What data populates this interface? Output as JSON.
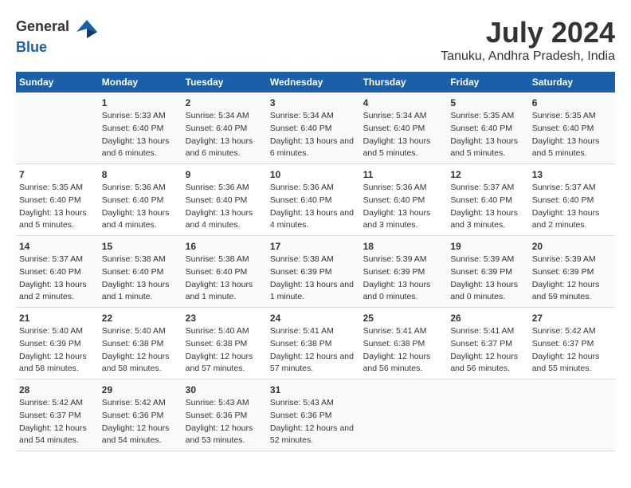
{
  "header": {
    "logo_general": "General",
    "logo_blue": "Blue",
    "month_year": "July 2024",
    "location": "Tanuku, Andhra Pradesh, India"
  },
  "days_of_week": [
    "Sunday",
    "Monday",
    "Tuesday",
    "Wednesday",
    "Thursday",
    "Friday",
    "Saturday"
  ],
  "weeks": [
    [
      {
        "day": "",
        "sunrise": "",
        "sunset": "",
        "daylight": ""
      },
      {
        "day": "1",
        "sunrise": "Sunrise: 5:33 AM",
        "sunset": "Sunset: 6:40 PM",
        "daylight": "Daylight: 13 hours and 6 minutes."
      },
      {
        "day": "2",
        "sunrise": "Sunrise: 5:34 AM",
        "sunset": "Sunset: 6:40 PM",
        "daylight": "Daylight: 13 hours and 6 minutes."
      },
      {
        "day": "3",
        "sunrise": "Sunrise: 5:34 AM",
        "sunset": "Sunset: 6:40 PM",
        "daylight": "Daylight: 13 hours and 6 minutes."
      },
      {
        "day": "4",
        "sunrise": "Sunrise: 5:34 AM",
        "sunset": "Sunset: 6:40 PM",
        "daylight": "Daylight: 13 hours and 5 minutes."
      },
      {
        "day": "5",
        "sunrise": "Sunrise: 5:35 AM",
        "sunset": "Sunset: 6:40 PM",
        "daylight": "Daylight: 13 hours and 5 minutes."
      },
      {
        "day": "6",
        "sunrise": "Sunrise: 5:35 AM",
        "sunset": "Sunset: 6:40 PM",
        "daylight": "Daylight: 13 hours and 5 minutes."
      }
    ],
    [
      {
        "day": "7",
        "sunrise": "Sunrise: 5:35 AM",
        "sunset": "Sunset: 6:40 PM",
        "daylight": "Daylight: 13 hours and 5 minutes."
      },
      {
        "day": "8",
        "sunrise": "Sunrise: 5:36 AM",
        "sunset": "Sunset: 6:40 PM",
        "daylight": "Daylight: 13 hours and 4 minutes."
      },
      {
        "day": "9",
        "sunrise": "Sunrise: 5:36 AM",
        "sunset": "Sunset: 6:40 PM",
        "daylight": "Daylight: 13 hours and 4 minutes."
      },
      {
        "day": "10",
        "sunrise": "Sunrise: 5:36 AM",
        "sunset": "Sunset: 6:40 PM",
        "daylight": "Daylight: 13 hours and 4 minutes."
      },
      {
        "day": "11",
        "sunrise": "Sunrise: 5:36 AM",
        "sunset": "Sunset: 6:40 PM",
        "daylight": "Daylight: 13 hours and 3 minutes."
      },
      {
        "day": "12",
        "sunrise": "Sunrise: 5:37 AM",
        "sunset": "Sunset: 6:40 PM",
        "daylight": "Daylight: 13 hours and 3 minutes."
      },
      {
        "day": "13",
        "sunrise": "Sunrise: 5:37 AM",
        "sunset": "Sunset: 6:40 PM",
        "daylight": "Daylight: 13 hours and 2 minutes."
      }
    ],
    [
      {
        "day": "14",
        "sunrise": "Sunrise: 5:37 AM",
        "sunset": "Sunset: 6:40 PM",
        "daylight": "Daylight: 13 hours and 2 minutes."
      },
      {
        "day": "15",
        "sunrise": "Sunrise: 5:38 AM",
        "sunset": "Sunset: 6:40 PM",
        "daylight": "Daylight: 13 hours and 1 minute."
      },
      {
        "day": "16",
        "sunrise": "Sunrise: 5:38 AM",
        "sunset": "Sunset: 6:40 PM",
        "daylight": "Daylight: 13 hours and 1 minute."
      },
      {
        "day": "17",
        "sunrise": "Sunrise: 5:38 AM",
        "sunset": "Sunset: 6:39 PM",
        "daylight": "Daylight: 13 hours and 1 minute."
      },
      {
        "day": "18",
        "sunrise": "Sunrise: 5:39 AM",
        "sunset": "Sunset: 6:39 PM",
        "daylight": "Daylight: 13 hours and 0 minutes."
      },
      {
        "day": "19",
        "sunrise": "Sunrise: 5:39 AM",
        "sunset": "Sunset: 6:39 PM",
        "daylight": "Daylight: 13 hours and 0 minutes."
      },
      {
        "day": "20",
        "sunrise": "Sunrise: 5:39 AM",
        "sunset": "Sunset: 6:39 PM",
        "daylight": "Daylight: 12 hours and 59 minutes."
      }
    ],
    [
      {
        "day": "21",
        "sunrise": "Sunrise: 5:40 AM",
        "sunset": "Sunset: 6:39 PM",
        "daylight": "Daylight: 12 hours and 58 minutes."
      },
      {
        "day": "22",
        "sunrise": "Sunrise: 5:40 AM",
        "sunset": "Sunset: 6:38 PM",
        "daylight": "Daylight: 12 hours and 58 minutes."
      },
      {
        "day": "23",
        "sunrise": "Sunrise: 5:40 AM",
        "sunset": "Sunset: 6:38 PM",
        "daylight": "Daylight: 12 hours and 57 minutes."
      },
      {
        "day": "24",
        "sunrise": "Sunrise: 5:41 AM",
        "sunset": "Sunset: 6:38 PM",
        "daylight": "Daylight: 12 hours and 57 minutes."
      },
      {
        "day": "25",
        "sunrise": "Sunrise: 5:41 AM",
        "sunset": "Sunset: 6:38 PM",
        "daylight": "Daylight: 12 hours and 56 minutes."
      },
      {
        "day": "26",
        "sunrise": "Sunrise: 5:41 AM",
        "sunset": "Sunset: 6:37 PM",
        "daylight": "Daylight: 12 hours and 56 minutes."
      },
      {
        "day": "27",
        "sunrise": "Sunrise: 5:42 AM",
        "sunset": "Sunset: 6:37 PM",
        "daylight": "Daylight: 12 hours and 55 minutes."
      }
    ],
    [
      {
        "day": "28",
        "sunrise": "Sunrise: 5:42 AM",
        "sunset": "Sunset: 6:37 PM",
        "daylight": "Daylight: 12 hours and 54 minutes."
      },
      {
        "day": "29",
        "sunrise": "Sunrise: 5:42 AM",
        "sunset": "Sunset: 6:36 PM",
        "daylight": "Daylight: 12 hours and 54 minutes."
      },
      {
        "day": "30",
        "sunrise": "Sunrise: 5:43 AM",
        "sunset": "Sunset: 6:36 PM",
        "daylight": "Daylight: 12 hours and 53 minutes."
      },
      {
        "day": "31",
        "sunrise": "Sunrise: 5:43 AM",
        "sunset": "Sunset: 6:36 PM",
        "daylight": "Daylight: 12 hours and 52 minutes."
      },
      {
        "day": "",
        "sunrise": "",
        "sunset": "",
        "daylight": ""
      },
      {
        "day": "",
        "sunrise": "",
        "sunset": "",
        "daylight": ""
      },
      {
        "day": "",
        "sunrise": "",
        "sunset": "",
        "daylight": ""
      }
    ]
  ]
}
